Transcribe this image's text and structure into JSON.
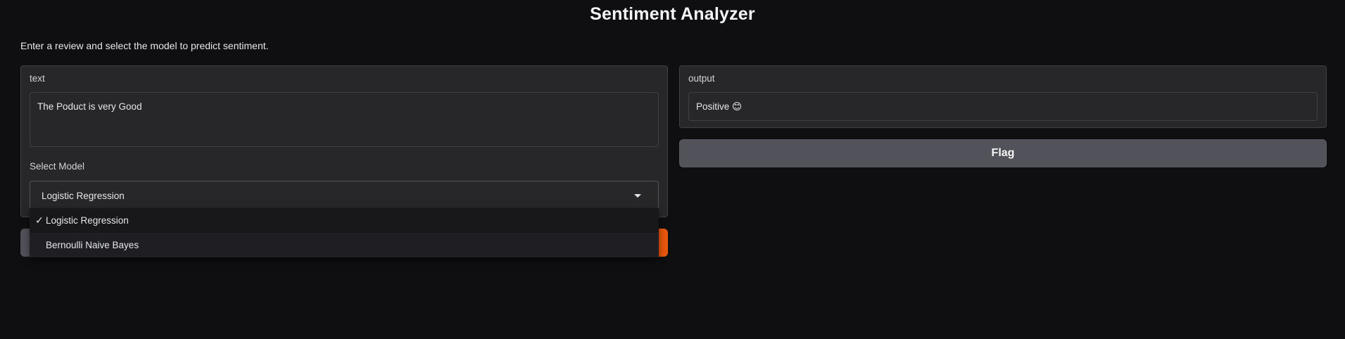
{
  "app": {
    "title": "Sentiment Analyzer",
    "description": "Enter a review and select the model to predict sentiment."
  },
  "inputs": {
    "text_label": "text",
    "text_value": "The Poduct is very Good",
    "model_label": "Select Model",
    "model_selected": "Logistic Regression",
    "model_options": [
      {
        "label": "Logistic Regression",
        "selected": true,
        "check": "✓"
      },
      {
        "label": "Bernoulli Naive Bayes",
        "selected": false,
        "check": ""
      }
    ]
  },
  "outputs": {
    "label": "output",
    "value": "Positive 😊"
  },
  "buttons": {
    "flag_label": "Flag"
  },
  "colors": {
    "background": "#0f0f11",
    "panel": "#27272a",
    "primary_button": "#ea580c",
    "secondary_button": "#52525b"
  },
  "icons": {
    "dropdown": "chevron-down-icon",
    "selected": "check-icon"
  }
}
